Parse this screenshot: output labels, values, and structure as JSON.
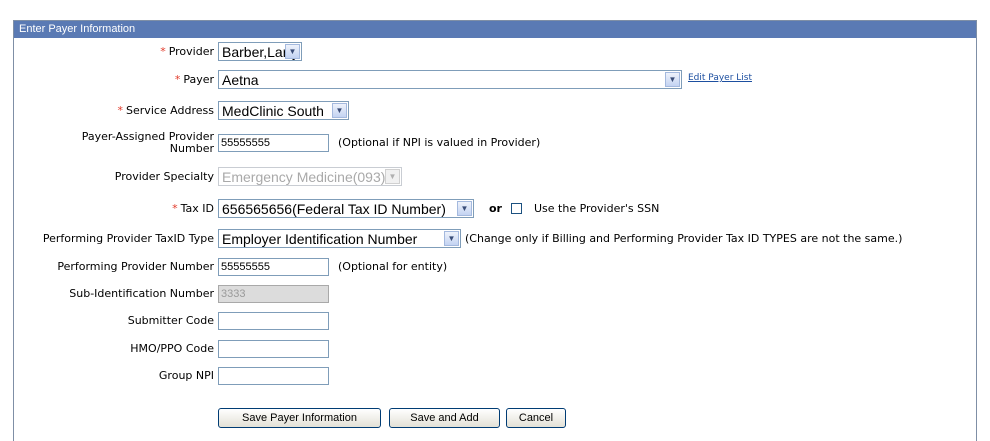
{
  "header": {
    "title": "Enter Payer Information"
  },
  "required_marker": "*",
  "fields": {
    "provider": {
      "label": "Provider",
      "value": "Barber,Larry"
    },
    "payer": {
      "label": "Payer",
      "value": "Aetna",
      "link": "Edit Payer List"
    },
    "service_address": {
      "label": "Service Address",
      "value": "MedClinic South"
    },
    "payer_assigned_number": {
      "label_line1": "Payer-Assigned Provider",
      "label_line2": "Number",
      "value": "55555555",
      "hint": "(Optional if NPI is valued in Provider)"
    },
    "provider_specialty": {
      "label": "Provider Specialty",
      "value": "Emergency Medicine(093)"
    },
    "tax_id": {
      "label": "Tax ID",
      "value": "656565656(Federal Tax ID Number)",
      "or_text": "or",
      "checkbox_label": "Use the Provider's SSN"
    },
    "performing_taxid_type": {
      "label": "Performing Provider TaxID Type",
      "value": "Employer Identification Number",
      "hint": "(Change only if Billing and Performing Provider Tax ID TYPES are not the same.)"
    },
    "performing_provider_number": {
      "label": "Performing Provider Number",
      "value": "55555555",
      "hint": "(Optional for entity)"
    },
    "sub_identification_number": {
      "label": "Sub-Identification Number",
      "value": "3333"
    },
    "submitter_code": {
      "label": "Submitter Code",
      "value": ""
    },
    "hmo_ppo_code": {
      "label": "HMO/PPO Code",
      "value": ""
    },
    "group_npi": {
      "label": "Group NPI",
      "value": ""
    }
  },
  "buttons": {
    "save": "Save Payer Information",
    "save_add": "Save and Add",
    "cancel": "Cancel"
  },
  "icons": {
    "dropdown": "chevron-down-icon"
  },
  "colors": {
    "header_bg": "#5a7ab4",
    "required": "#e23a2a",
    "link": "#1d4fa0"
  }
}
